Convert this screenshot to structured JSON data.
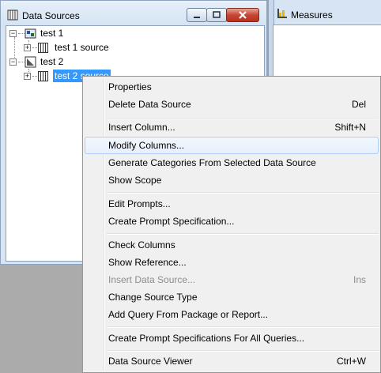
{
  "data_sources_pane": {
    "title": "Data Sources",
    "tree": [
      {
        "label": "test 1",
        "expand": "−",
        "icon": "package-icon"
      },
      {
        "label": "test 1 source",
        "expand": "+",
        "icon": "table-icon"
      },
      {
        "label": "test 2",
        "expand": "−",
        "icon": "query-icon"
      },
      {
        "label": "test 2 source",
        "expand": "+",
        "icon": "table-icon",
        "selected": true
      }
    ]
  },
  "measures_pane": {
    "title": "Measures"
  },
  "context_menu": {
    "items": [
      {
        "label": "Properties",
        "shortcut": ""
      },
      {
        "label": "Delete Data Source",
        "shortcut": "Del"
      },
      {
        "label": "Insert Column...",
        "shortcut": "Shift+N"
      },
      {
        "label": "Modify Columns...",
        "shortcut": "",
        "hover": true
      },
      {
        "label": "Generate Categories From Selected Data Source",
        "shortcut": ""
      },
      {
        "label": "Show Scope",
        "shortcut": ""
      },
      {
        "label": "Edit Prompts...",
        "shortcut": ""
      },
      {
        "label": "Create Prompt Specification...",
        "shortcut": ""
      },
      {
        "label": "Check Columns",
        "shortcut": ""
      },
      {
        "label": "Show Reference...",
        "shortcut": ""
      },
      {
        "label": "Insert Data Source...",
        "shortcut": "Ins",
        "disabled": true
      },
      {
        "label": "Change Source Type",
        "shortcut": ""
      },
      {
        "label": "Add Query From Package or Report...",
        "shortcut": ""
      },
      {
        "label": "Create Prompt Specifications For All Queries...",
        "shortcut": ""
      },
      {
        "label": "Data Source Viewer",
        "shortcut": "Ctrl+W"
      }
    ]
  },
  "colors": {
    "selection": "#3399ff",
    "pane_bg": "#d6e4f3",
    "close_button": "#c74533"
  }
}
